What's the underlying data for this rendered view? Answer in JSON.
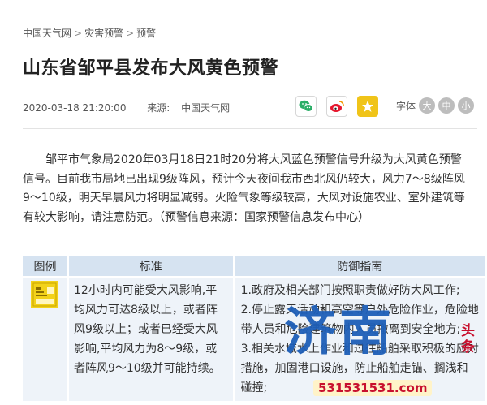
{
  "breadcrumb": {
    "items": [
      "中国天气网",
      "灾害预警",
      "预警"
    ],
    "separator": ">"
  },
  "article": {
    "title": "山东省邹平县发布大风黄色预警",
    "datetime": "2020-03-18 21:20:00",
    "source_label": "来源:",
    "source": "中国天气网",
    "body": "邹平市气象局2020年03月18日21时20分将大风蓝色预警信号升级为大风黄色预警信号。目前我市局地已出现9级阵风，预计今天夜间我市西北风仍较大，风力7～8级阵风9～10级，明天早晨风力将明显减弱。火险气象等级较高，大风对设施农业、室外建筑等有较大影响，请注意防范。（预警信息来源：国家预警信息发布中心）"
  },
  "share": {
    "icons": [
      "wechat-icon",
      "weibo-icon",
      "favorite-icon"
    ],
    "colors": {
      "wechat": "#2aae67",
      "weibo": "#e6162d",
      "favorite": "#f0c419"
    }
  },
  "font_size": {
    "label": "字体",
    "options": [
      "大",
      "中",
      "小"
    ]
  },
  "table": {
    "headers": [
      "图例",
      "标准",
      "防御指南"
    ],
    "standard": "12小时内可能受大风影响,平均风力可达8级以上，或者阵风9级以上；或者已经受大风影响,平均风力为8～9级，或者阵风9～10级并可能持续。",
    "guide": [
      "1.政府及相关部门按照职责做好防大风工作;",
      "2.停止露天活动和高空等户外危险作业，危险地带人员和危险建筑物内人员撤离到安全地方;",
      "3.相关水域水上作业和过往船舶采取积极的应对措施，加固港口设施，防止船舶走锚、搁浅和碰撞;"
    ]
  },
  "watermark": {
    "main": "济南",
    "side": "头条",
    "phone": "531531531.com"
  }
}
